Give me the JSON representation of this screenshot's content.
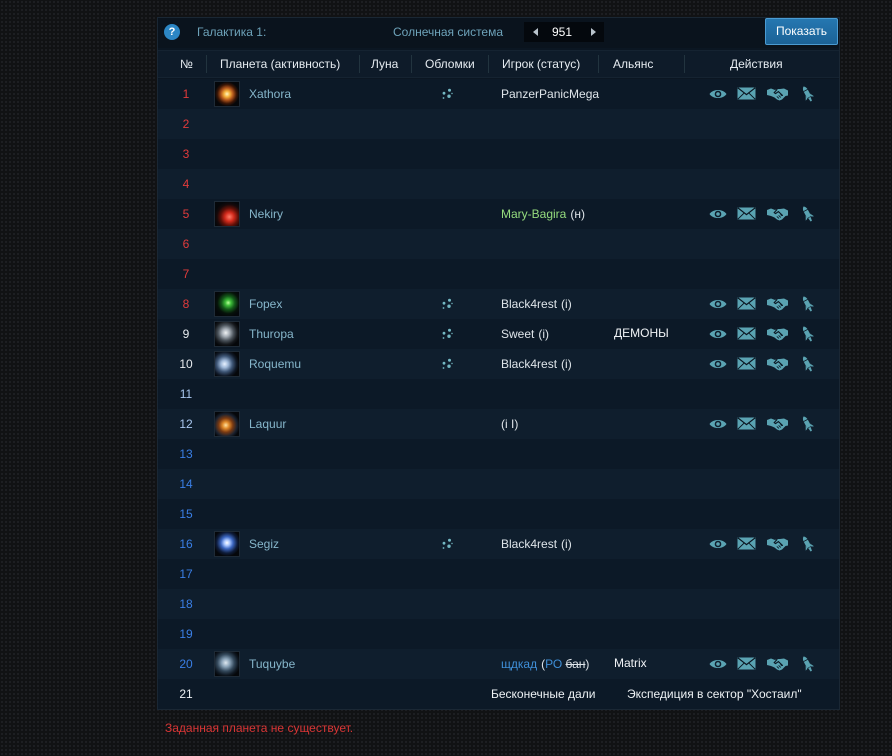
{
  "header": {
    "help_icon": "question-circle-icon",
    "galaxy_label": "Галактика 1:",
    "system_label": "Солнечная система",
    "prev_icon": "triangle-left-icon",
    "system_number": "951",
    "next_icon": "triangle-right-icon",
    "show_button": "Показать"
  },
  "columns": {
    "position": "№",
    "planet": "Планета (активность)",
    "moon": "Луна",
    "debris": "Обломки",
    "player": "Игрок (статус)",
    "alliance": "Альянс",
    "actions": "Действия"
  },
  "action_icons": [
    "eye-icon",
    "envelope-icon",
    "handshake-icon",
    "missile-icon"
  ],
  "colors": {
    "accent": "#2c86c4",
    "icon": "#5aa3b2",
    "debris": "#74b9c4",
    "hot": "#e23b3b",
    "neutral": "#e8ecef",
    "cool": "#a9c8f0",
    "cold": "#3a7fe6",
    "error": "#d83535"
  },
  "rows": [
    {
      "position": "1",
      "pos_color": "#e23b3b",
      "planet": {
        "name": "Xathora",
        "image": "planet-yellow"
      },
      "debris": true,
      "player": {
        "name": "PanzerPanicMega",
        "status": []
      },
      "actions": true
    },
    {
      "position": "2",
      "pos_color": "#e23b3b"
    },
    {
      "position": "3",
      "pos_color": "#e23b3b"
    },
    {
      "position": "4",
      "pos_color": "#e23b3b"
    },
    {
      "position": "5",
      "pos_color": "#e23b3b",
      "planet": {
        "name": "Nekiry",
        "image": "planet-red"
      },
      "debris": false,
      "player": {
        "name": "Mary-Bagira",
        "color": "#95dc7e",
        "status": [
          {
            "text": "(н)"
          }
        ]
      },
      "actions": true
    },
    {
      "position": "6",
      "pos_color": "#e23b3b"
    },
    {
      "position": "7",
      "pos_color": "#e23b3b"
    },
    {
      "position": "8",
      "pos_color": "#e23b3b",
      "planet": {
        "name": "Fopex",
        "image": "planet-green"
      },
      "debris": true,
      "player": {
        "name": "Black4rest",
        "status": [
          {
            "text": "(i)"
          }
        ]
      },
      "actions": true
    },
    {
      "position": "9",
      "pos_color": "#e8ecef",
      "planet": {
        "name": "Thuropa",
        "image": "planet-gray"
      },
      "debris": true,
      "player": {
        "name": "Sweet",
        "status": [
          {
            "text": "(i)"
          }
        ]
      },
      "alliance": "ДЕМОНЫ",
      "actions": true
    },
    {
      "position": "10",
      "pos_color": "#e8ecef",
      "planet": {
        "name": "Roquemu",
        "image": "planet-steel"
      },
      "debris": true,
      "player": {
        "name": "Black4rest",
        "status": [
          {
            "text": "(i)"
          }
        ]
      },
      "actions": true
    },
    {
      "position": "11",
      "pos_color": "#a9c8f0"
    },
    {
      "position": "12",
      "pos_color": "#a9c8f0",
      "planet": {
        "name": "Laquur",
        "image": "planet-amber"
      },
      "debris": false,
      "player": {
        "name": "",
        "status": [
          {
            "text": "(i I)"
          }
        ]
      },
      "actions": true
    },
    {
      "position": "13",
      "pos_color": "#3a7fe6"
    },
    {
      "position": "14",
      "pos_color": "#3a7fe6"
    },
    {
      "position": "15",
      "pos_color": "#3a7fe6"
    },
    {
      "position": "16",
      "pos_color": "#3a7fe6",
      "planet": {
        "name": "Segiz",
        "image": "planet-blue"
      },
      "debris": true,
      "player": {
        "name": "Black4rest",
        "status": [
          {
            "text": "(i)"
          }
        ]
      },
      "actions": true
    },
    {
      "position": "17",
      "pos_color": "#3a7fe6"
    },
    {
      "position": "18",
      "pos_color": "#3a7fe6"
    },
    {
      "position": "19",
      "pos_color": "#3a7fe6"
    },
    {
      "position": "20",
      "pos_color": "#3a7fe6",
      "planet": {
        "name": "Tuquybe",
        "image": "planet-slate"
      },
      "debris": false,
      "player": {
        "name": "щдкад",
        "color": "#3f8fd8",
        "status": [
          {
            "text": "("
          },
          {
            "text": "РО ",
            "color": "#3f8fd8"
          },
          {
            "text": "бан",
            "strike": true
          },
          {
            "text": ")"
          }
        ]
      },
      "alliance": "Matrix",
      "actions": true
    }
  ],
  "expedition": {
    "position": "21",
    "pos_color": "#eef2f5",
    "name": "Бесконечные дали",
    "mission": "Экспедиция в сектор \"Хостаил\""
  },
  "message": "Заданная планета не существует."
}
